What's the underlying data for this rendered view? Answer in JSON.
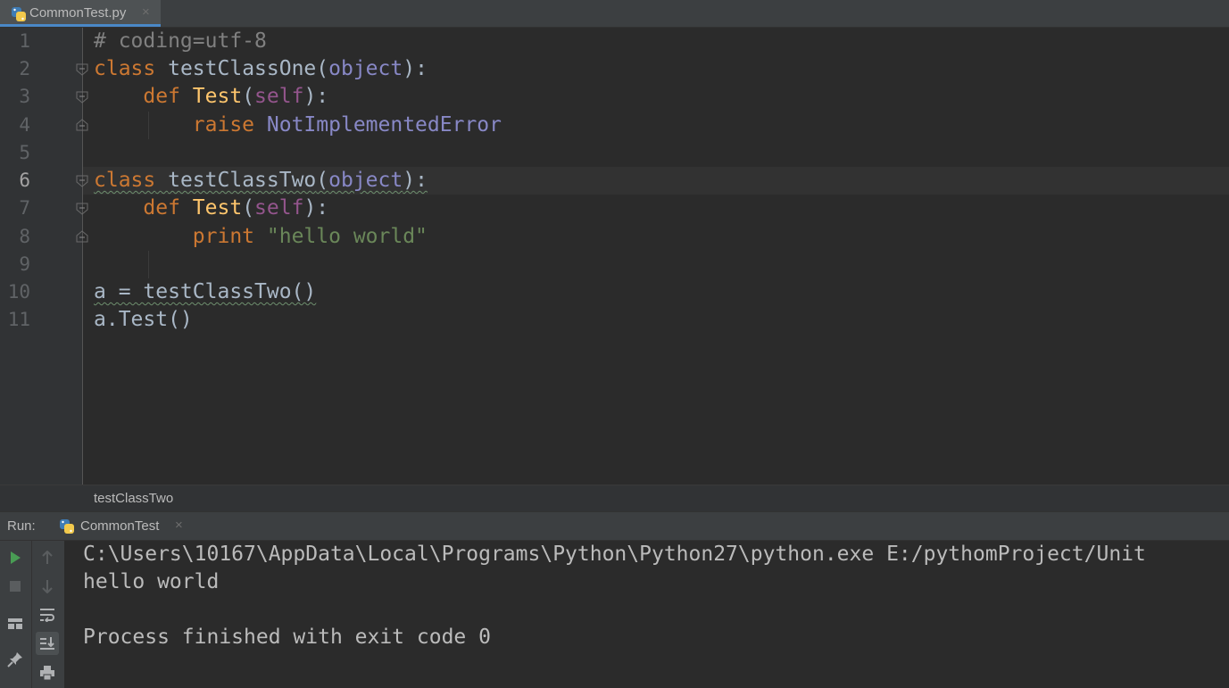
{
  "tab": {
    "filename": "CommonTest.py",
    "close": "×",
    "icon": "python-file-icon"
  },
  "editor": {
    "line_numbers": [
      "1",
      "2",
      "3",
      "4",
      "5",
      "6",
      "7",
      "8",
      "9",
      "10",
      "11"
    ],
    "active_line": "6",
    "code": {
      "l1": {
        "comment": "# coding=utf-8"
      },
      "l2": {
        "kw": "class",
        "name": "testClassOne",
        "open": "(",
        "base": "object",
        "close": "):"
      },
      "l3": {
        "kw": "def",
        "name": "Test",
        "open": "(",
        "arg": "self",
        "close": "):"
      },
      "l4": {
        "kw": "raise",
        "name": "NotImplementedError"
      },
      "l6": {
        "kw": "class",
        "name": "testClassTwo",
        "open": "(",
        "base": "object",
        "close": "):"
      },
      "l7": {
        "kw": "def",
        "name": "Test",
        "open": "(",
        "arg": "self",
        "close": "):"
      },
      "l8": {
        "kw": "print",
        "string": "\"hello world\""
      },
      "l10": {
        "text": "a = testClassTwo()"
      },
      "l11": {
        "text": "a.Test()"
      }
    }
  },
  "breadcrumb": {
    "text": "testClassTwo"
  },
  "run": {
    "label": "Run:",
    "tab_label": "CommonTest",
    "tab_close": "×",
    "tools": [
      "run-icon",
      "stop-icon",
      "up-arrow-icon",
      "down-arrow-icon",
      "layout-icon",
      "soft-wrap-icon",
      "scroll-to-end-icon",
      "pin-icon",
      "print-icon"
    ],
    "console": [
      "C:\\Users\\10167\\AppData\\Local\\Programs\\Python\\Python27\\python.exe E:/pythomProject/Unit",
      "hello world",
      "",
      "Process finished with exit code 0"
    ]
  },
  "colors": {
    "background": "#2b2b2b",
    "gutter": "#313335",
    "keyword": "#cc7832",
    "function": "#ffc66d",
    "builtin": "#8888c6",
    "self": "#94558d",
    "string": "#6a8759",
    "comment": "#808080",
    "accent": "#4a88c7",
    "run_green": "#499c54"
  }
}
